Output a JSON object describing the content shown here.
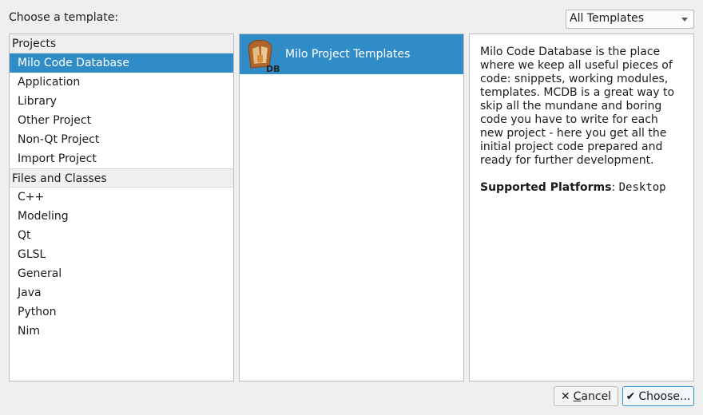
{
  "header": {
    "choose_label": "Choose a template:",
    "filter_value": "All Templates"
  },
  "categories": {
    "groups": [
      {
        "title": "Projects",
        "items": [
          "Milo Code Database",
          "Application",
          "Library",
          "Other Project",
          "Non-Qt Project",
          "Import Project"
        ]
      },
      {
        "title": "Files and Classes",
        "items": [
          "C++",
          "Modeling",
          "Qt",
          "GLSL",
          "General",
          "Java",
          "Python",
          "Nim"
        ]
      }
    ],
    "selected": "Milo Code Database"
  },
  "templates": {
    "items": [
      {
        "name": "Milo Project Templates",
        "icon": "mcdb-icon",
        "icon_text": "DB"
      }
    ]
  },
  "description": {
    "text": "Milo Code Database is the place where we keep all useful pieces of code: snippets, working modules, templates. MCDB is a great way to skip all the mundane and boring code you have to write for each new project - here you get all the initial project code prepared and ready for further development.",
    "platforms_label": "Supported Platforms",
    "platforms_sep": ":",
    "platforms_value": "Desktop"
  },
  "buttons": {
    "cancel_label_u": "C",
    "cancel_label_rest": "ancel",
    "choose_label": "Choose...",
    "cancel_icon": "close-icon",
    "choose_icon": "check-icon"
  },
  "colors": {
    "selection": "#308cc6",
    "window": "#efefef"
  }
}
